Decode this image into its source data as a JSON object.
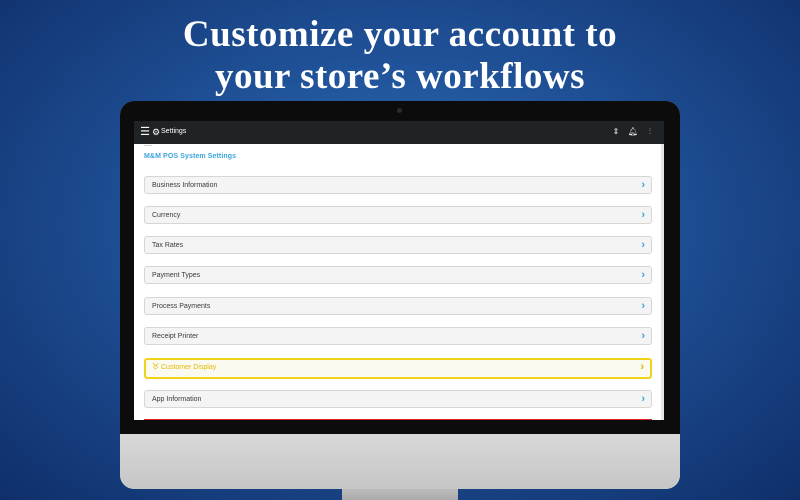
{
  "headline": {
    "line1": "Customize your account to",
    "line2": "your store’s workflows"
  },
  "app": {
    "topbar": {
      "title": "Settings",
      "icons": [
        "menu-icon",
        "gear-icon",
        "sync-icon",
        "bell-icon",
        "sliders-icon"
      ]
    },
    "section_title": "M&M POS System Settings",
    "rows": [
      {
        "label": "Business Information"
      },
      {
        "label": "Currency"
      },
      {
        "label": "Tax Rates"
      },
      {
        "label": "Payment Types"
      },
      {
        "label": "Process Payments"
      },
      {
        "label": "Receipt Printer"
      },
      {
        "label": "Customer Display",
        "highlighted": true,
        "icon": "badge-icon"
      },
      {
        "label": "App Information"
      }
    ]
  },
  "colors": {
    "background": "#1f5096",
    "topbar": "#1f2326",
    "accent": "#3aa3dc",
    "highlight": "#f0d21b",
    "alert": "#e0242a"
  }
}
